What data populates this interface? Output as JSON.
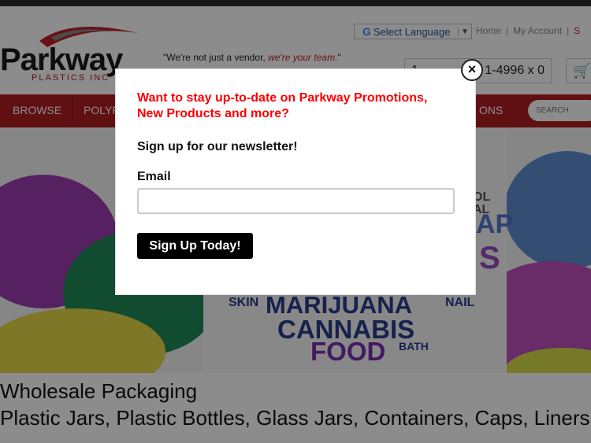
{
  "header": {
    "logo_name": "Parkway",
    "logo_sub": "PLASTICS INC",
    "tagline_start": "\"We're not just a vendor, ",
    "tagline_em": "we're your team.",
    "tagline_end": "\"",
    "language_label": "Select Language",
    "links": {
      "home": "Home",
      "account": "My Account",
      "extra": "S"
    },
    "phone_prefix": "1",
    "phone_number": "1-4996 x 0"
  },
  "nav": {
    "items": [
      "BROWSE",
      "POLYP",
      "ONS"
    ],
    "search_placeholder": "SEARCH"
  },
  "hero": {
    "lines": [
      "OL",
      "AL",
      "AP",
      "S",
      "SKIN",
      "MARIJUANA",
      "NAIL",
      "CANNABIS",
      "FOOD",
      "BATH"
    ]
  },
  "main": {
    "heading1": "Wholesale Packaging",
    "heading2": "Plastic Jars, Plastic Bottles, Glass Jars, Containers, Caps, Liners an"
  },
  "modal": {
    "title_line1": "Want to stay up-to-date on Parkway Promotions,",
    "title_line2": "New Products and more?",
    "subtitle": "Sign up for our newsletter!",
    "email_label": "Email",
    "email_value": "",
    "submit_label": "Sign Up Today!",
    "close_label": "×"
  },
  "colors": {
    "brand_red": "#b01c24",
    "promo_red": "#ff0000",
    "button_black": "#000000"
  }
}
